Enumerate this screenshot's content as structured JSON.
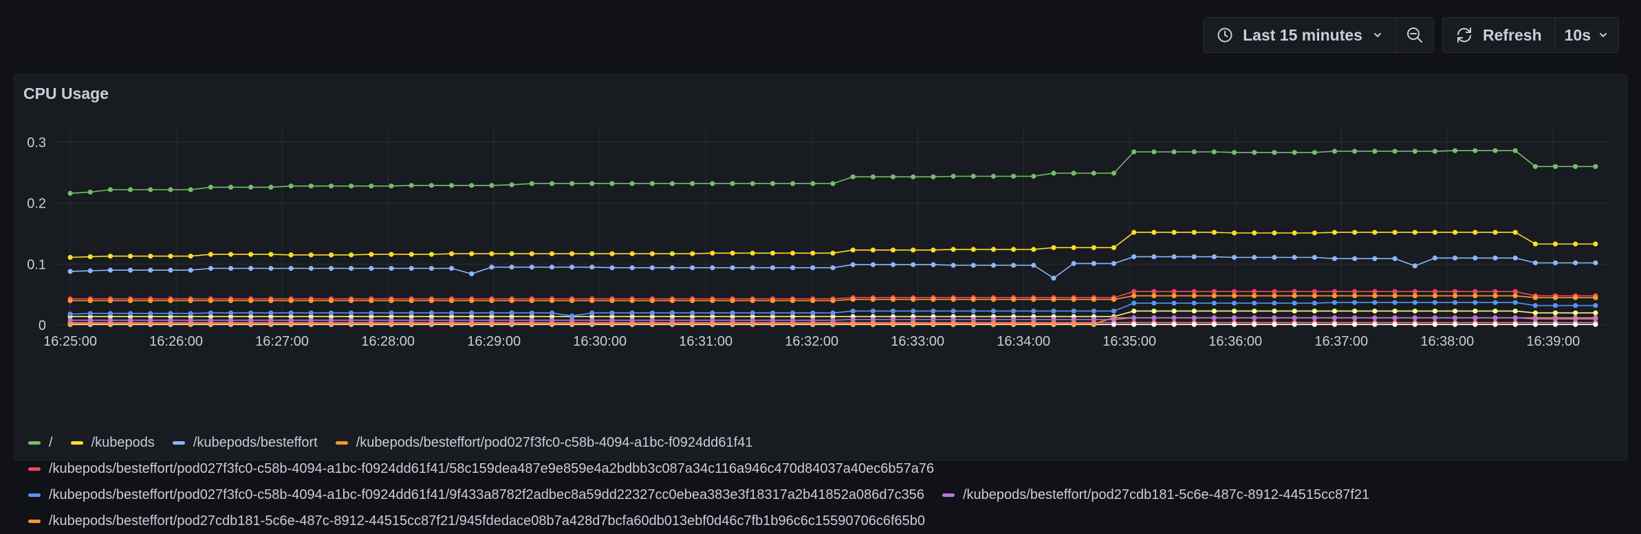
{
  "toolbar": {
    "time_range_label": "Last 15 minutes",
    "refresh_label": "Refresh",
    "refresh_interval": "10s"
  },
  "panel": {
    "title": "CPU Usage"
  },
  "chart_data": {
    "type": "line",
    "title": "CPU Usage",
    "x_tick_labels": [
      "16:25:00",
      "16:26:00",
      "16:27:00",
      "16:28:00",
      "16:29:00",
      "16:30:00",
      "16:31:00",
      "16:32:00",
      "16:33:00",
      "16:34:00",
      "16:35:00",
      "16:36:00",
      "16:37:00",
      "16:38:00",
      "16:39:00"
    ],
    "x_unit": "minutes after 16:25:00",
    "xlim": [
      -0.15,
      14.55
    ],
    "y_ticks": [
      0,
      0.1,
      0.2,
      0.3
    ],
    "y_tick_labels": [
      "0",
      "0.1",
      "0.2",
      "0.3"
    ],
    "ylim": [
      0,
      0.32
    ],
    "grid": true,
    "legend_position": "bottom",
    "series": [
      {
        "name": "/",
        "color": "#73bf69",
        "values": [
          0.216,
          0.218,
          0.222,
          0.222,
          0.222,
          0.222,
          0.222,
          0.226,
          0.226,
          0.226,
          0.226,
          0.228,
          0.228,
          0.228,
          0.228,
          0.228,
          0.228,
          0.229,
          0.229,
          0.229,
          0.229,
          0.229,
          0.23,
          0.232,
          0.232,
          0.232,
          0.232,
          0.232,
          0.232,
          0.232,
          0.232,
          0.232,
          0.232,
          0.232,
          0.232,
          0.232,
          0.232,
          0.232,
          0.232,
          0.243,
          0.243,
          0.243,
          0.243,
          0.243,
          0.244,
          0.244,
          0.244,
          0.244,
          0.244,
          0.249,
          0.249,
          0.249,
          0.249,
          0.284,
          0.284,
          0.284,
          0.284,
          0.284,
          0.283,
          0.283,
          0.283,
          0.283,
          0.283,
          0.285,
          0.285,
          0.285,
          0.285,
          0.285,
          0.285,
          0.286,
          0.286,
          0.286,
          0.286,
          0.26,
          0.26,
          0.26,
          0.26
        ]
      },
      {
        "name": "/kubepods",
        "color": "#fade2a",
        "values": [
          0.111,
          0.112,
          0.113,
          0.113,
          0.113,
          0.113,
          0.113,
          0.116,
          0.116,
          0.116,
          0.116,
          0.115,
          0.115,
          0.115,
          0.115,
          0.116,
          0.116,
          0.116,
          0.116,
          0.117,
          0.117,
          0.117,
          0.117,
          0.117,
          0.117,
          0.117,
          0.117,
          0.117,
          0.117,
          0.117,
          0.117,
          0.117,
          0.118,
          0.118,
          0.118,
          0.118,
          0.118,
          0.118,
          0.118,
          0.123,
          0.123,
          0.123,
          0.123,
          0.123,
          0.124,
          0.124,
          0.124,
          0.124,
          0.124,
          0.127,
          0.127,
          0.127,
          0.127,
          0.152,
          0.152,
          0.152,
          0.152,
          0.152,
          0.151,
          0.151,
          0.151,
          0.151,
          0.151,
          0.152,
          0.152,
          0.152,
          0.152,
          0.152,
          0.152,
          0.152,
          0.152,
          0.152,
          0.152,
          0.133,
          0.133,
          0.133,
          0.133
        ]
      },
      {
        "name": "/kubepods/besteffort",
        "color": "#8ab8ff",
        "values": [
          0.088,
          0.089,
          0.09,
          0.09,
          0.09,
          0.09,
          0.09,
          0.093,
          0.093,
          0.093,
          0.093,
          0.093,
          0.093,
          0.093,
          0.093,
          0.093,
          0.093,
          0.093,
          0.093,
          0.093,
          0.084,
          0.095,
          0.095,
          0.095,
          0.095,
          0.095,
          0.095,
          0.094,
          0.094,
          0.094,
          0.094,
          0.094,
          0.094,
          0.094,
          0.094,
          0.094,
          0.094,
          0.094,
          0.094,
          0.099,
          0.099,
          0.099,
          0.099,
          0.099,
          0.098,
          0.098,
          0.098,
          0.098,
          0.098,
          0.077,
          0.101,
          0.101,
          0.101,
          0.112,
          0.112,
          0.112,
          0.112,
          0.112,
          0.111,
          0.111,
          0.111,
          0.111,
          0.111,
          0.109,
          0.109,
          0.109,
          0.109,
          0.097,
          0.11,
          0.11,
          0.11,
          0.11,
          0.11,
          0.102,
          0.102,
          0.102,
          0.102
        ]
      },
      {
        "name": "/kubepods/besteffort/pod027f3fc0-c58b-4094-a1bc-f0924dd61f41",
        "color": "#ff9830",
        "values": [
          0.04,
          0.04,
          0.04,
          0.04,
          0.04,
          0.04,
          0.04,
          0.04,
          0.04,
          0.04,
          0.04,
          0.04,
          0.04,
          0.04,
          0.04,
          0.04,
          0.04,
          0.04,
          0.04,
          0.04,
          0.04,
          0.04,
          0.04,
          0.04,
          0.04,
          0.04,
          0.04,
          0.04,
          0.04,
          0.04,
          0.04,
          0.04,
          0.04,
          0.04,
          0.04,
          0.04,
          0.04,
          0.04,
          0.04,
          0.042,
          0.042,
          0.042,
          0.042,
          0.042,
          0.042,
          0.042,
          0.042,
          0.042,
          0.042,
          0.042,
          0.042,
          0.042,
          0.042,
          0.048,
          0.048,
          0.048,
          0.048,
          0.048,
          0.048,
          0.048,
          0.048,
          0.048,
          0.048,
          0.048,
          0.048,
          0.048,
          0.048,
          0.048,
          0.048,
          0.048,
          0.048,
          0.048,
          0.048,
          0.045,
          0.045,
          0.045,
          0.045
        ]
      },
      {
        "name": "/kubepods/besteffort/pod027f3fc0-c58b-4094-a1bc-f0924dd61f41/58c159dea487e9e859e4a2bdbb3c087a34c116a946c470d84037a40ec6b57a76",
        "color": "#f2495c",
        "values": [
          0.043,
          0.043,
          0.043,
          0.043,
          0.043,
          0.043,
          0.043,
          0.043,
          0.043,
          0.043,
          0.043,
          0.043,
          0.043,
          0.043,
          0.043,
          0.043,
          0.043,
          0.043,
          0.043,
          0.043,
          0.043,
          0.043,
          0.043,
          0.043,
          0.043,
          0.043,
          0.043,
          0.043,
          0.043,
          0.043,
          0.043,
          0.043,
          0.043,
          0.043,
          0.043,
          0.043,
          0.043,
          0.043,
          0.043,
          0.045,
          0.045,
          0.045,
          0.045,
          0.045,
          0.045,
          0.045,
          0.045,
          0.045,
          0.045,
          0.045,
          0.045,
          0.045,
          0.045,
          0.055,
          0.055,
          0.055,
          0.055,
          0.055,
          0.055,
          0.055,
          0.055,
          0.055,
          0.055,
          0.055,
          0.055,
          0.055,
          0.055,
          0.055,
          0.055,
          0.055,
          0.055,
          0.055,
          0.055,
          0.048,
          0.048,
          0.048,
          0.048
        ]
      },
      {
        "name": "/kubepods/besteffort/pod027f3fc0-c58b-4094-a1bc-f0924dd61f41/9f433a8782f2adbec8a59dd22327cc0ebea383e3f18317a2b41852a086d7c356",
        "color": "#5794f2",
        "values": [
          0.018,
          0.019,
          0.019,
          0.019,
          0.019,
          0.019,
          0.019,
          0.02,
          0.02,
          0.02,
          0.02,
          0.02,
          0.02,
          0.02,
          0.02,
          0.02,
          0.02,
          0.02,
          0.02,
          0.02,
          0.02,
          0.02,
          0.02,
          0.02,
          0.02,
          0.015,
          0.02,
          0.02,
          0.02,
          0.02,
          0.02,
          0.02,
          0.02,
          0.02,
          0.02,
          0.02,
          0.02,
          0.02,
          0.02,
          0.023,
          0.023,
          0.023,
          0.023,
          0.023,
          0.023,
          0.023,
          0.023,
          0.023,
          0.023,
          0.023,
          0.023,
          0.023,
          0.023,
          0.036,
          0.036,
          0.036,
          0.036,
          0.036,
          0.036,
          0.036,
          0.036,
          0.036,
          0.036,
          0.037,
          0.037,
          0.037,
          0.037,
          0.037,
          0.037,
          0.037,
          0.037,
          0.037,
          0.037,
          0.032,
          0.032,
          0.032,
          0.032
        ]
      },
      {
        "name": "/kubepods/besteffort/pod27cdb181-5c6e-487c-8912-44515cc87f21",
        "color": "#b877d9",
        "values": [
          0.008,
          0.008,
          0.008,
          0.008,
          0.008,
          0.008,
          0.008,
          0.008,
          0.008,
          0.008,
          0.008,
          0.008,
          0.008,
          0.008,
          0.008,
          0.008,
          0.008,
          0.008,
          0.008,
          0.008,
          0.008,
          0.008,
          0.008,
          0.008,
          0.008,
          0.008,
          0.008,
          0.008,
          0.008,
          0.008,
          0.008,
          0.008,
          0.008,
          0.008,
          0.008,
          0.008,
          0.008,
          0.008,
          0.008,
          0.009,
          0.009,
          0.009,
          0.009,
          0.009,
          0.009,
          0.009,
          0.009,
          0.009,
          0.009,
          0.009,
          0.009,
          0.009,
          0.009,
          0.012,
          0.012,
          0.012,
          0.012,
          0.012,
          0.012,
          0.012,
          0.012,
          0.012,
          0.012,
          0.012,
          0.012,
          0.012,
          0.012,
          0.012,
          0.012,
          0.012,
          0.012,
          0.012,
          0.012,
          0.01,
          0.01,
          0.01,
          0.01
        ]
      },
      {
        "name": "/kubepods/besteffort/pod27cdb181-5c6e-487c-8912-44515cc87f21/945fdedace08b7a428d7bcfa60db013ebf0d46c7fb1b96c6c15590706c6f65b0",
        "color": "#ff9830",
        "values": [
          0.002,
          0.002,
          0.002,
          0.002,
          0.002,
          0.002,
          0.002,
          0.002,
          0.002,
          0.002,
          0.002,
          0.002,
          0.002,
          0.002,
          0.002,
          0.002,
          0.002,
          0.002,
          0.002,
          0.002,
          0.002,
          0.002,
          0.002,
          0.002,
          0.002,
          0.002,
          0.002,
          0.002,
          0.002,
          0.002,
          0.002,
          0.002,
          0.002,
          0.002,
          0.002,
          0.002,
          0.002,
          0.002,
          0.002,
          0.002,
          0.002,
          0.002,
          0.002,
          0.002,
          0.002,
          0.002,
          0.002,
          0.002,
          0.002,
          0.002,
          0.002,
          0.002,
          0.012,
          0.012,
          0.012,
          0.012,
          0.012,
          0.012,
          0.012,
          0.012,
          0.012,
          0.012,
          0.012,
          0.012,
          0.012,
          0.012,
          0.012,
          0.012,
          0.012,
          0.012,
          0.012,
          0.012,
          0.012,
          0.012,
          0.012,
          0.012,
          0.012
        ]
      },
      {
        "name": "",
        "color": "#fff899",
        "values": [
          0.014,
          0.014,
          0.014,
          0.014,
          0.014,
          0.014,
          0.014,
          0.014,
          0.014,
          0.014,
          0.014,
          0.014,
          0.014,
          0.014,
          0.014,
          0.014,
          0.014,
          0.014,
          0.014,
          0.014,
          0.014,
          0.014,
          0.014,
          0.014,
          0.014,
          0.014,
          0.014,
          0.014,
          0.014,
          0.014,
          0.014,
          0.014,
          0.014,
          0.014,
          0.014,
          0.014,
          0.014,
          0.014,
          0.014,
          0.014,
          0.014,
          0.014,
          0.014,
          0.014,
          0.014,
          0.014,
          0.014,
          0.014,
          0.014,
          0.014,
          0.014,
          0.014,
          0.014,
          0.023,
          0.023,
          0.023,
          0.023,
          0.023,
          0.023,
          0.023,
          0.023,
          0.023,
          0.023,
          0.023,
          0.023,
          0.023,
          0.023,
          0.023,
          0.023,
          0.023,
          0.023,
          0.023,
          0.023,
          0.02,
          0.02,
          0.02,
          0.02
        ]
      },
      {
        "name": "",
        "color": "#ffffff",
        "values": [
          0.001,
          0.001,
          0.001,
          0.001,
          0.001,
          0.001,
          0.001,
          0.001,
          0.001,
          0.001,
          0.001,
          0.001,
          0.001,
          0.001,
          0.001,
          0.001,
          0.001,
          0.001,
          0.001,
          0.001,
          0.001,
          0.001,
          0.001,
          0.001,
          0.001,
          0.001,
          0.001,
          0.001,
          0.001,
          0.001,
          0.001,
          0.001,
          0.001,
          0.001,
          0.001,
          0.001,
          0.001,
          0.001,
          0.001,
          0.001,
          0.001,
          0.001,
          0.001,
          0.001,
          0.001,
          0.001,
          0.001,
          0.001,
          0.001,
          0.001,
          0.001,
          0.001,
          0.001,
          0.001,
          0.001,
          0.001,
          0.001,
          0.001,
          0.001,
          0.001,
          0.001,
          0.001,
          0.001,
          0.001,
          0.001,
          0.001,
          0.001,
          0.001,
          0.001,
          0.001,
          0.001,
          0.001,
          0.001,
          0.001,
          0.001,
          0.001,
          0.001
        ]
      },
      {
        "name": "",
        "color": "#ff7383",
        "values": [
          0.004,
          0.004,
          0.004,
          0.004,
          0.004,
          0.004,
          0.004,
          0.004,
          0.004,
          0.004,
          0.004,
          0.004,
          0.004,
          0.004,
          0.004,
          0.004,
          0.004,
          0.004,
          0.004,
          0.004,
          0.004,
          0.004,
          0.004,
          0.004,
          0.004,
          0.004,
          0.004,
          0.004,
          0.004,
          0.004,
          0.004,
          0.004,
          0.004,
          0.004,
          0.004,
          0.004,
          0.004,
          0.004,
          0.004,
          0.004,
          0.004,
          0.004,
          0.004,
          0.004,
          0.004,
          0.004,
          0.004,
          0.004,
          0.004,
          0.004,
          0.004,
          0.004,
          0.004,
          0.004,
          0.004,
          0.004,
          0.004,
          0.004,
          0.004,
          0.004,
          0.004,
          0.004,
          0.004,
          0.004,
          0.004,
          0.004,
          0.004,
          0.004,
          0.004,
          0.004,
          0.004,
          0.004,
          0.004,
          0.004,
          0.004,
          0.004,
          0.004
        ]
      }
    ]
  }
}
